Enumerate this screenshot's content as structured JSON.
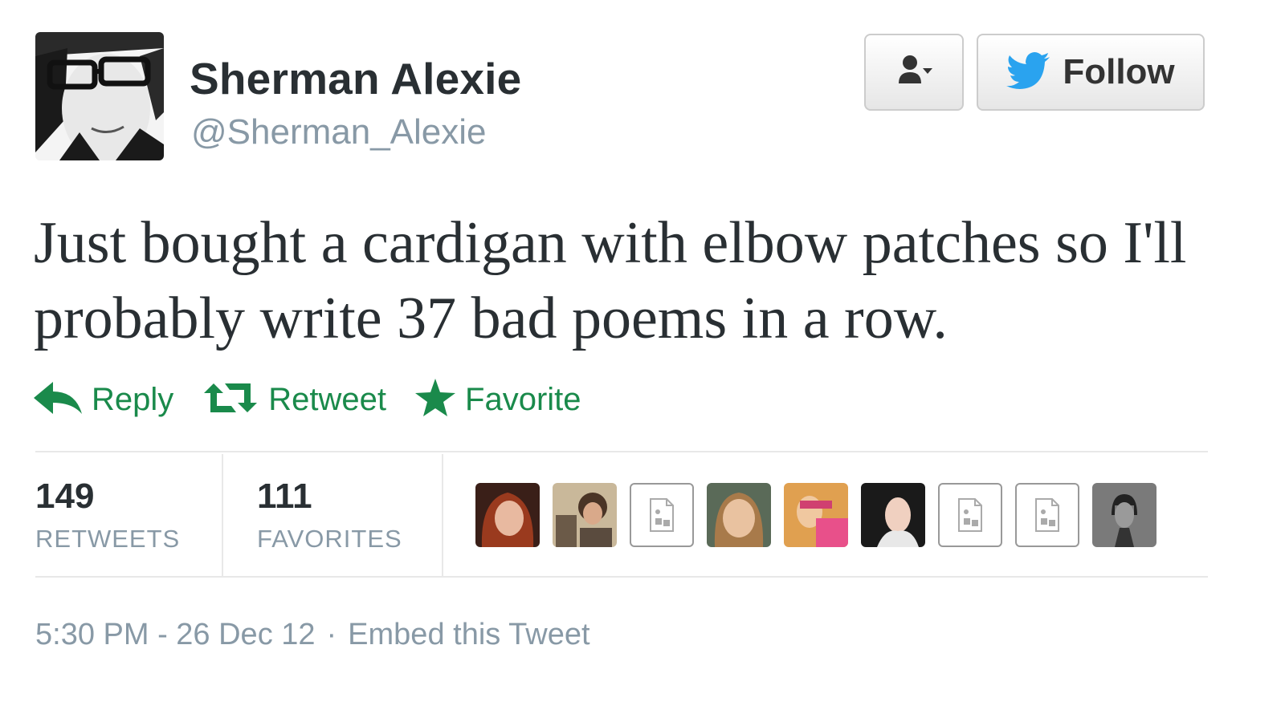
{
  "author": {
    "name": "Sherman Alexie",
    "handle": "@Sherman_Alexie",
    "avatar_icon": "user-avatar-photo"
  },
  "buttons": {
    "user_dropdown_icon": "person-dropdown-icon",
    "follow_label": "Follow",
    "follow_icon": "twitter-bird-icon"
  },
  "tweet": {
    "text": "Just bought a cardigan with elbow patches so I'll probably write 37 bad poems in a row."
  },
  "actions": [
    {
      "label": "Reply",
      "icon": "reply-arrow-icon"
    },
    {
      "label": "Retweet",
      "icon": "retweet-icon"
    },
    {
      "label": "Favorite",
      "icon": "star-icon"
    }
  ],
  "stats": {
    "retweets": {
      "count": "149",
      "label": "RETWEETS"
    },
    "favorites": {
      "count": "111",
      "label": "FAVORITES"
    }
  },
  "favoriters": [
    {
      "type": "photo"
    },
    {
      "type": "photo"
    },
    {
      "type": "placeholder"
    },
    {
      "type": "photo"
    },
    {
      "type": "photo"
    },
    {
      "type": "photo"
    },
    {
      "type": "placeholder"
    },
    {
      "type": "placeholder"
    },
    {
      "type": "photo"
    }
  ],
  "meta": {
    "timestamp": "5:30 PM - 26 Dec 12",
    "separator": "·",
    "embed_label": "Embed this Tweet"
  },
  "colors": {
    "action_green": "#1a8a4b",
    "twitter_blue": "#2aa3ef",
    "muted_gray": "#8899a6"
  }
}
